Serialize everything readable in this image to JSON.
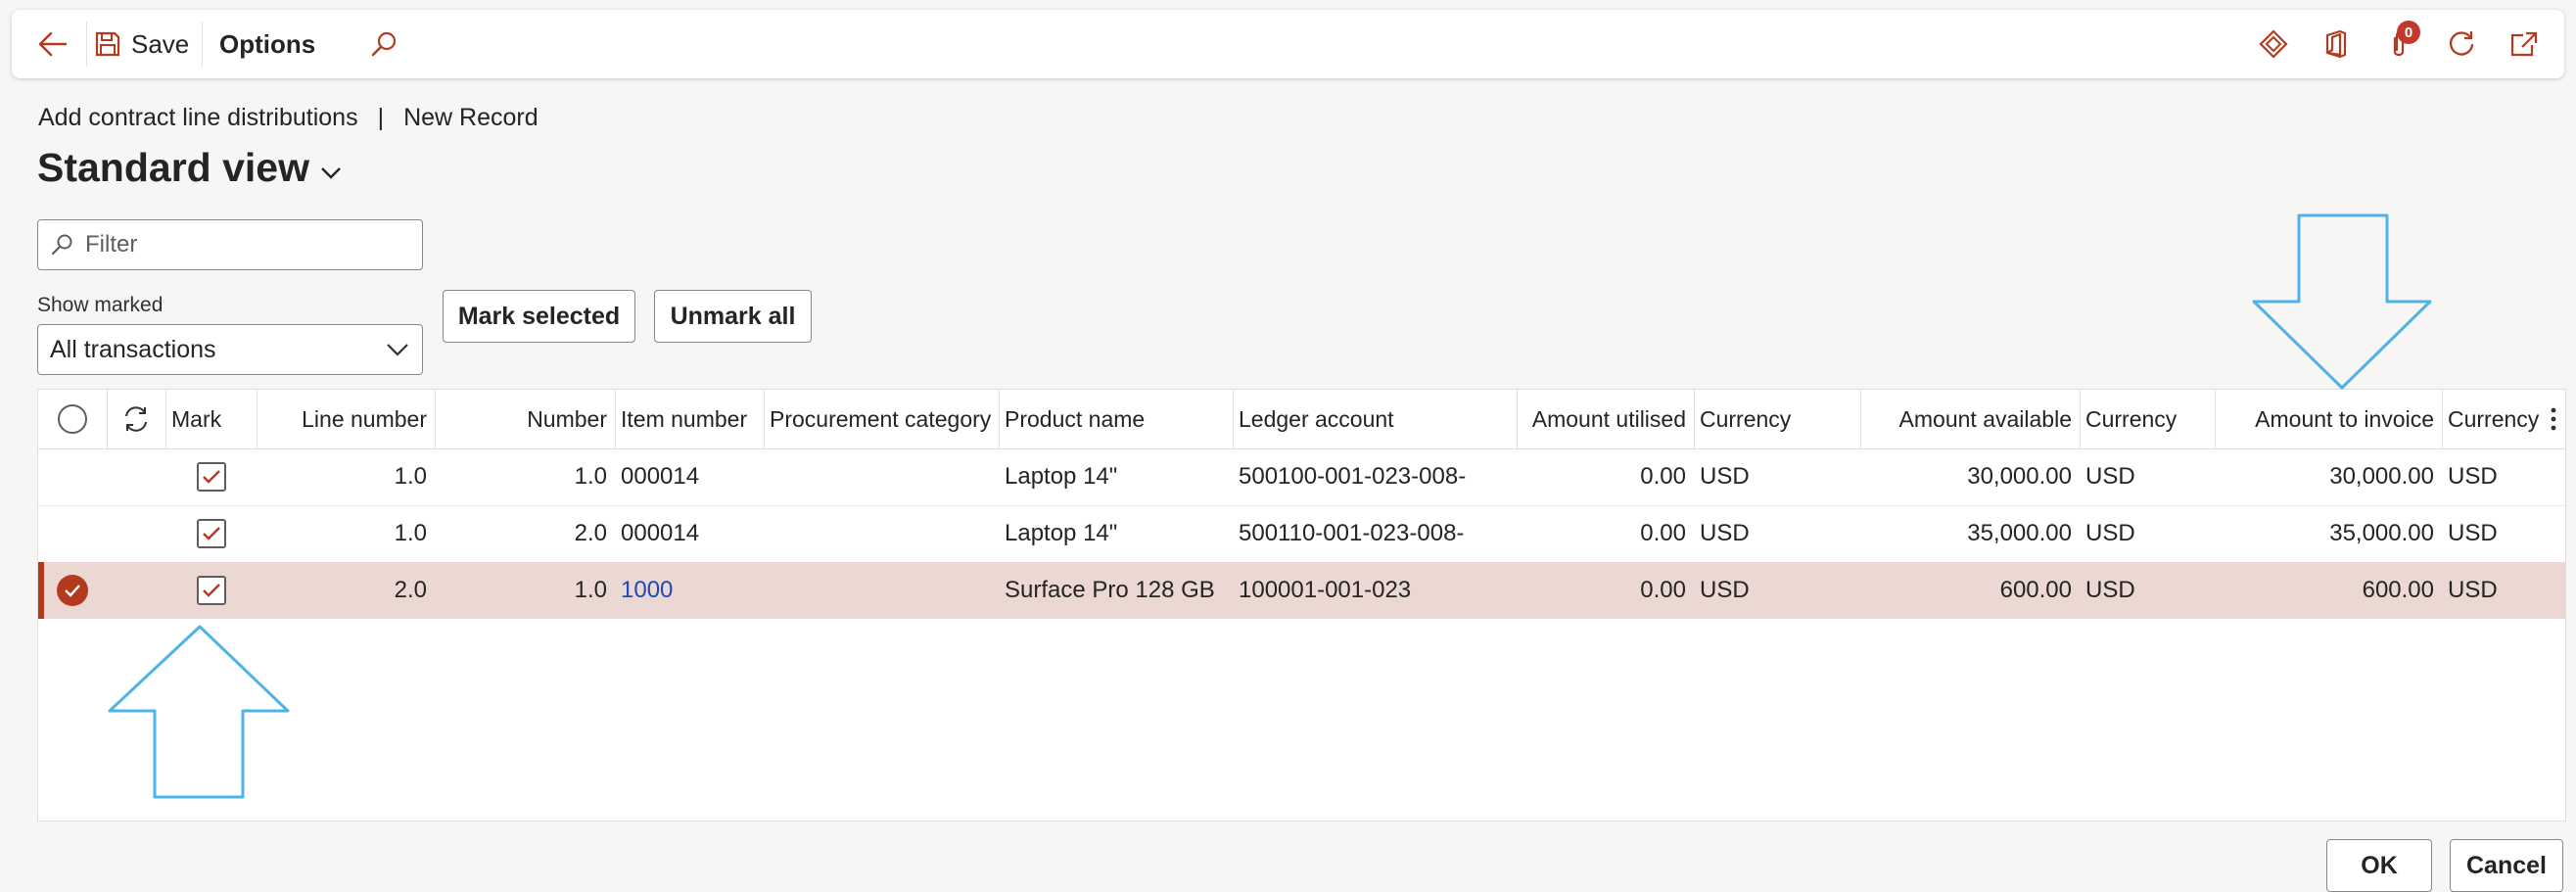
{
  "toolbar": {
    "save_label": "Save",
    "options_label": "Options",
    "notification_count": "0"
  },
  "header": {
    "breadcrumb_page": "Add contract line distributions",
    "breadcrumb_separator": "|",
    "breadcrumb_record": "New Record",
    "title": "Standard view"
  },
  "filter": {
    "placeholder": "Filter"
  },
  "show_marked": {
    "label": "Show marked",
    "selected": "All transactions"
  },
  "buttons": {
    "mark_selected": "Mark selected",
    "unmark_all": "Unmark all",
    "ok": "OK",
    "cancel": "Cancel"
  },
  "grid": {
    "columns": [
      "Mark",
      "Line number",
      "Number",
      "Item number",
      "Procurement category",
      "Product name",
      "Ledger account",
      "Amount utilised",
      "Currency",
      "Amount available",
      "Currency",
      "Amount to invoice",
      "Currency"
    ],
    "rows": [
      {
        "selected": false,
        "marked": true,
        "line_number": "1.0",
        "number": "1.0",
        "item_number": "000014",
        "procurement_category": "",
        "product_name": "Laptop 14\"",
        "ledger_account": "500100-001-023-008-",
        "amount_utilised": "0.00",
        "currency1": "USD",
        "amount_available": "30,000.00",
        "currency2": "USD",
        "amount_to_invoice": "30,000.00",
        "currency3": "USD"
      },
      {
        "selected": false,
        "marked": true,
        "line_number": "1.0",
        "number": "2.0",
        "item_number": "000014",
        "procurement_category": "",
        "product_name": "Laptop 14\"",
        "ledger_account": "500110-001-023-008-",
        "amount_utilised": "0.00",
        "currency1": "USD",
        "amount_available": "35,000.00",
        "currency2": "USD",
        "amount_to_invoice": "35,000.00",
        "currency3": "USD"
      },
      {
        "selected": true,
        "marked": true,
        "line_number": "2.0",
        "number": "1.0",
        "item_number": "1000",
        "procurement_category": "",
        "product_name": "Surface Pro 128 GB",
        "ledger_account": "100001-001-023",
        "amount_utilised": "0.00",
        "currency1": "USD",
        "amount_available": "600.00",
        "currency2": "USD",
        "amount_to_invoice": "600.00",
        "currency3": "USD"
      }
    ]
  },
  "colors": {
    "accent": "#b33a1f",
    "selected_row": "#ecd8d2",
    "link": "#1e49b6",
    "annotation_arrow": "#4fb3e6"
  },
  "icons": [
    "back-arrow-icon",
    "save-icon",
    "search-icon",
    "diamond-icon",
    "office-icon",
    "attachment-icon",
    "refresh-icon",
    "open-new-window-icon",
    "chevron-down-icon",
    "filter-search-icon",
    "select-all-circle-icon",
    "refresh-grid-icon",
    "more-vertical-icon",
    "checkmark-icon"
  ]
}
